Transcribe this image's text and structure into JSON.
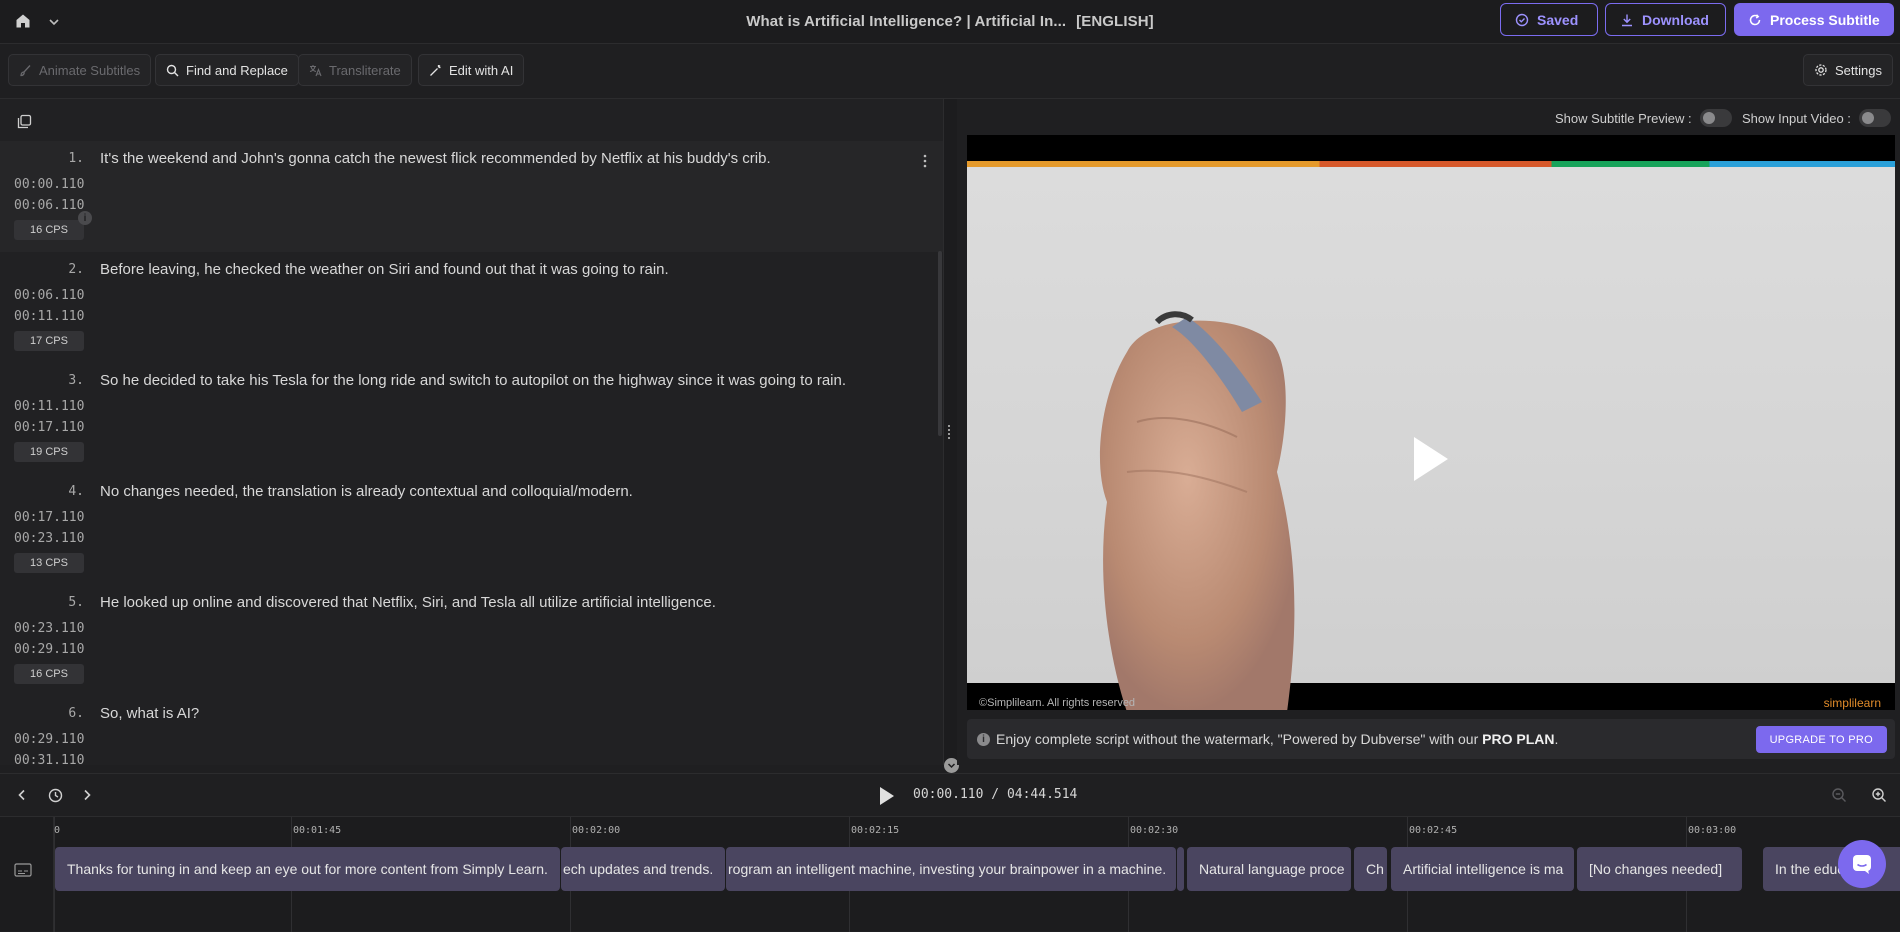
{
  "header": {
    "title": "What is Artificial Intelligence? | Artificial In...",
    "language": "[ENGLISH]",
    "saved_label": "Saved",
    "download_label": "Download",
    "process_label": "Process Subtitle"
  },
  "toolbar": {
    "animate_label": "Animate Subtitles",
    "find_replace_label": "Find and Replace",
    "transliterate_label": "Transliterate",
    "edit_ai_label": "Edit with AI",
    "settings_label": "Settings"
  },
  "subtitles": [
    {
      "num": "1.",
      "text": "It's the weekend and John's gonna catch the newest flick recommended by Netflix at his buddy's crib.",
      "start": "00:00.110",
      "end": "00:06.110",
      "cps": "16 CPS"
    },
    {
      "num": "2.",
      "text": "Before leaving, he checked the weather on Siri and found out that it was going to rain.",
      "start": "00:06.110",
      "end": "00:11.110",
      "cps": "17 CPS"
    },
    {
      "num": "3.",
      "text": "So he decided to take his Tesla for the long ride and switch to autopilot on the highway since it was going to rain.",
      "start": "00:11.110",
      "end": "00:17.110",
      "cps": "19 CPS"
    },
    {
      "num": "4.",
      "text": "No changes needed, the translation is already contextual and colloquial/modern.",
      "start": "00:17.110",
      "end": "00:23.110",
      "cps": "13 CPS"
    },
    {
      "num": "5.",
      "text": "He looked up online and discovered that Netflix, Siri, and Tesla all utilize artificial intelligence.",
      "start": "00:23.110",
      "end": "00:29.110",
      "cps": "16 CPS"
    },
    {
      "num": "6.",
      "text": "So, what is AI?",
      "start": "00:29.110",
      "end": "00:31.110",
      "cps": ""
    }
  ],
  "preview": {
    "show_subtitle_label": "Show Subtitle Preview :",
    "show_input_label": "Show Input Video :",
    "watermark_left": "©Simplilearn. All rights reserved",
    "watermark_right": "simplilearn"
  },
  "promo": {
    "text_before": "Enjoy complete script without the watermark, \"Powered by Dubverse\" with our ",
    "plan": "PRO PLAN",
    "text_after": ".",
    "upgrade_label": "UPGRADE TO PRO"
  },
  "player": {
    "current": "00:00.110",
    "separator": "/",
    "total": "04:44.514"
  },
  "timeline": {
    "ruler": [
      "0",
      "00:01:45",
      "00:02:00",
      "00:02:15",
      "00:02:30",
      "00:02:45",
      "00:03:00"
    ],
    "clips": [
      "Thanks for tuning in and keep an eye out for more content from Simply Learn.",
      "ech updates and trends.",
      "rogram an intelligent machine, investing your brainpower in a machine.",
      "Natural language proce",
      "Ch",
      "Artificial intelligence is ma",
      "[No changes needed]",
      "In the educ"
    ]
  }
}
